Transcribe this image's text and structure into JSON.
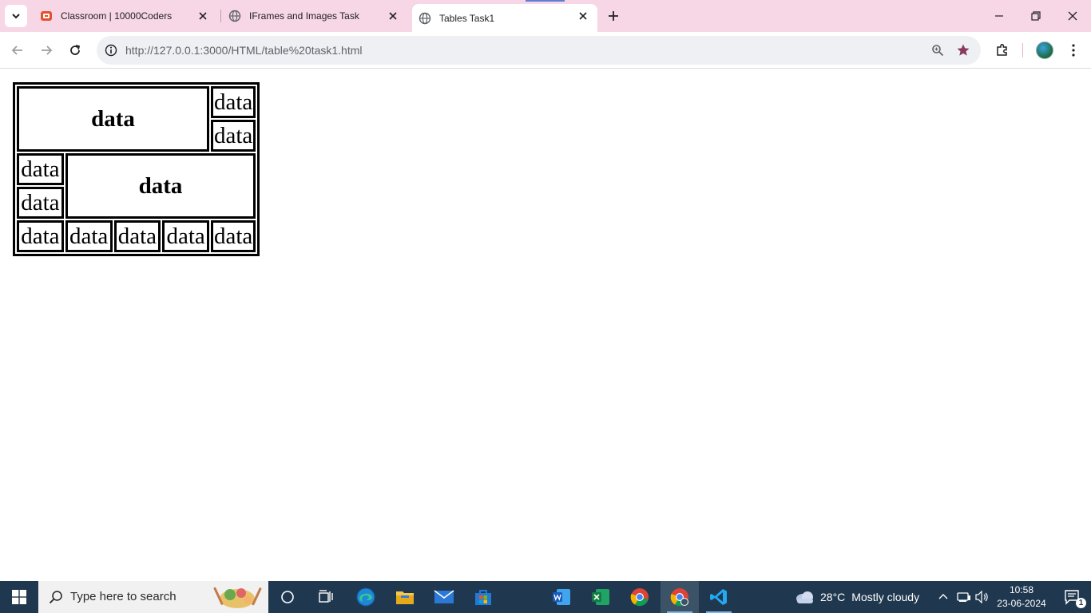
{
  "browser": {
    "tabs": [
      {
        "title": "Classroom | 10000Coders",
        "favicon": "10000coders-icon"
      },
      {
        "title": "IFrames and Images Task",
        "favicon": "globe-icon"
      },
      {
        "title": "Tables Task1",
        "favicon": "globe-icon",
        "active": true
      }
    ],
    "address_bar": {
      "url": "http://127.0.0.1:3000/HTML/table%20task1.html"
    }
  },
  "page": {
    "table": {
      "row1": {
        "merged_cell": "data",
        "right_top": "data",
        "right_bottom": "data"
      },
      "row2": {
        "left_top": "data",
        "left_bottom": "data",
        "merged_cell": "data"
      },
      "row3": [
        "data",
        "data",
        "data",
        "data",
        "data"
      ]
    }
  },
  "taskbar": {
    "search_placeholder": "Type here to search",
    "weather": {
      "temperature": "28°C",
      "condition": "Mostly cloudy"
    },
    "clock": {
      "time": "10:58",
      "date": "23-06-2024"
    },
    "notification_count": "1"
  },
  "colors": {
    "tabstrip_bg": "#f7d6e6",
    "taskbar_bg": "#20384f",
    "bookmark_star": "#8a3a5c"
  }
}
